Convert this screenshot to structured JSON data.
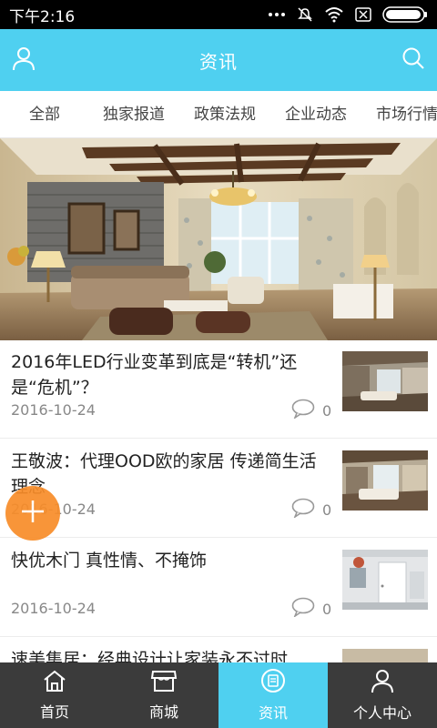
{
  "status_bar": {
    "time": "下午2:16"
  },
  "header": {
    "title": "资讯",
    "left_icon": "user-icon",
    "right_icon": "search-icon",
    "color": "#4fd0f0"
  },
  "categories": [
    {
      "label": "全部"
    },
    {
      "label": "独家报道"
    },
    {
      "label": "政策法规"
    },
    {
      "label": "企业动态"
    },
    {
      "label": "市场行情"
    }
  ],
  "news": [
    {
      "title": "2016年LED行业变革到底是“转机”还是“危机”？",
      "date": "2016-10-24",
      "comments": "0"
    },
    {
      "title": "王敬波：代理OOD欧的家居 传递简生活理念",
      "date": "2016-10-24",
      "comments": "0"
    },
    {
      "title": "快优木门 真性情、不掩饰",
      "date": "2016-10-24",
      "comments": "0"
    },
    {
      "title": "速美集居：经典设计让家装永不过时",
      "date": "",
      "comments": ""
    }
  ],
  "fab": {
    "icon": "plus-icon",
    "color": "#f78c28"
  },
  "bottom_nav": [
    {
      "label": "首页",
      "icon": "home-icon",
      "active": false
    },
    {
      "label": "商城",
      "icon": "shop-icon",
      "active": false
    },
    {
      "label": "资讯",
      "icon": "news-icon",
      "active": true
    },
    {
      "label": "个人中心",
      "icon": "person-icon",
      "active": false
    }
  ]
}
